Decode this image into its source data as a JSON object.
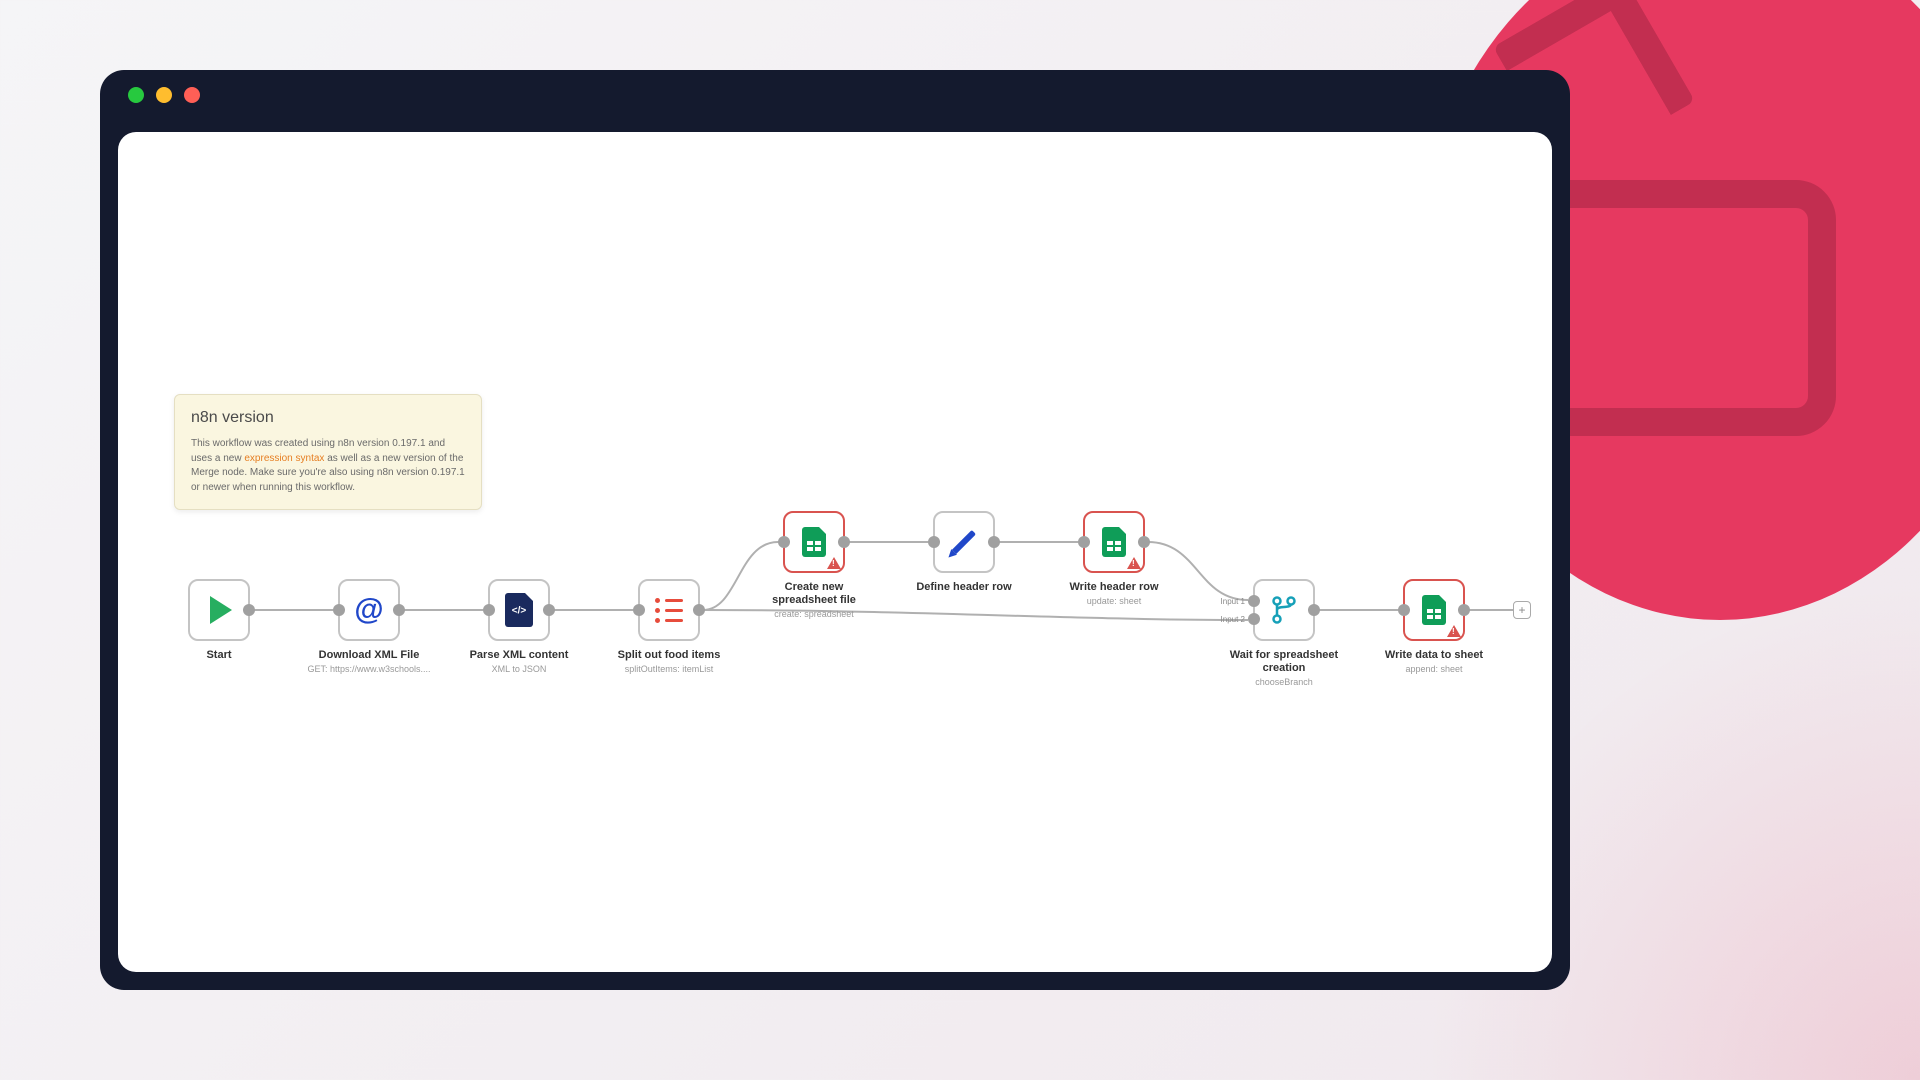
{
  "note": {
    "title": "n8n version",
    "body_pre": "This workflow was created using n8n version 0.197.1 and uses a new ",
    "body_link": "expression syntax",
    "body_post": " as well as a new version of the Merge node. Make sure you're also using n8n version 0.197.1 or newer when running this workflow."
  },
  "nodes": {
    "start": {
      "label": "Start"
    },
    "download": {
      "label": "Download XML File",
      "sub": "GET: https://www.w3schools...."
    },
    "parse": {
      "label": "Parse XML content",
      "sub": "XML to JSON"
    },
    "split": {
      "label": "Split out food items",
      "sub": "splitOutItems: itemList"
    },
    "create": {
      "label": "Create new spreadsheet file",
      "sub": "create: spreadsheet"
    },
    "define": {
      "label": "Define header row"
    },
    "writeheader": {
      "label": "Write header row",
      "sub": "update: sheet"
    },
    "wait": {
      "label": "Wait for spreadsheet creation",
      "sub": "chooseBranch",
      "input1": "Input 1",
      "input2": "Input 2"
    },
    "writedata": {
      "label": "Write data to sheet",
      "sub": "append: sheet"
    }
  },
  "addButton": "+"
}
